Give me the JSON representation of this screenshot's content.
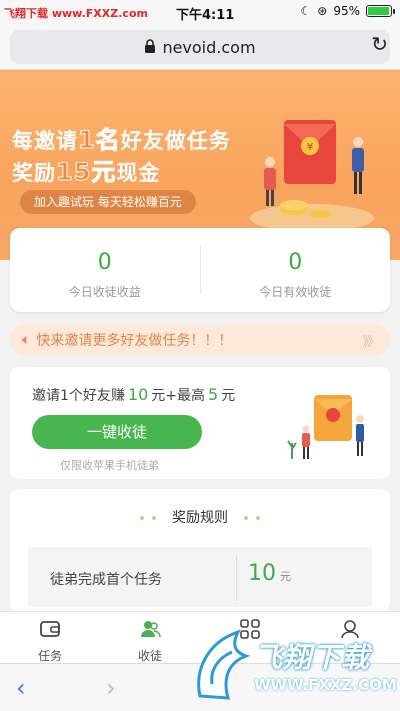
{
  "status": {
    "watermark": "飞翔下载 www.FXXZ.com",
    "time": "下午4:11",
    "battery": "95%",
    "battery_level": 0.95
  },
  "browser": {
    "url": "nevoid.com"
  },
  "banner": {
    "line1_pre": "每邀请",
    "line1_big": "1名",
    "line1_post": "好友做任务",
    "line2_pre": "奖励",
    "line2_big": "15元",
    "line2_post": "现金",
    "tagline": "加入趣试玩  每天轻松赚百元"
  },
  "stats": [
    {
      "value": "0",
      "label": "今日收徒收益"
    },
    {
      "value": "0",
      "label": "今日有效收徒"
    }
  ],
  "notice": {
    "text": "快来邀请更多好友做任务！！！",
    "arrows": "》》"
  },
  "invite": {
    "text_pre": "邀请1个好友赚",
    "amount1": "10",
    "text_mid": "元+最高",
    "amount2": "5",
    "text_post": "元",
    "button": "一键收徒",
    "hint": "仅限收苹果手机徒弟"
  },
  "rules": {
    "title": "奖励规则",
    "rows": [
      {
        "task": "徒弟完成首个任务",
        "reward": "10",
        "unit": "元"
      }
    ]
  },
  "tabs": [
    {
      "label": "任务",
      "icon": "wallet-icon"
    },
    {
      "label": "收徒",
      "icon": "people-icon"
    },
    {
      "label": "",
      "icon": "grid-icon"
    },
    {
      "label": "",
      "icon": "profile-icon"
    }
  ],
  "watermark_overlay": {
    "title": "飞翔下载",
    "url": "WWW.FXXZ.COM"
  },
  "colors": {
    "accent_green": "#3cab47",
    "banner_orange": "#f9a45e",
    "notice_text": "#e0844a"
  }
}
